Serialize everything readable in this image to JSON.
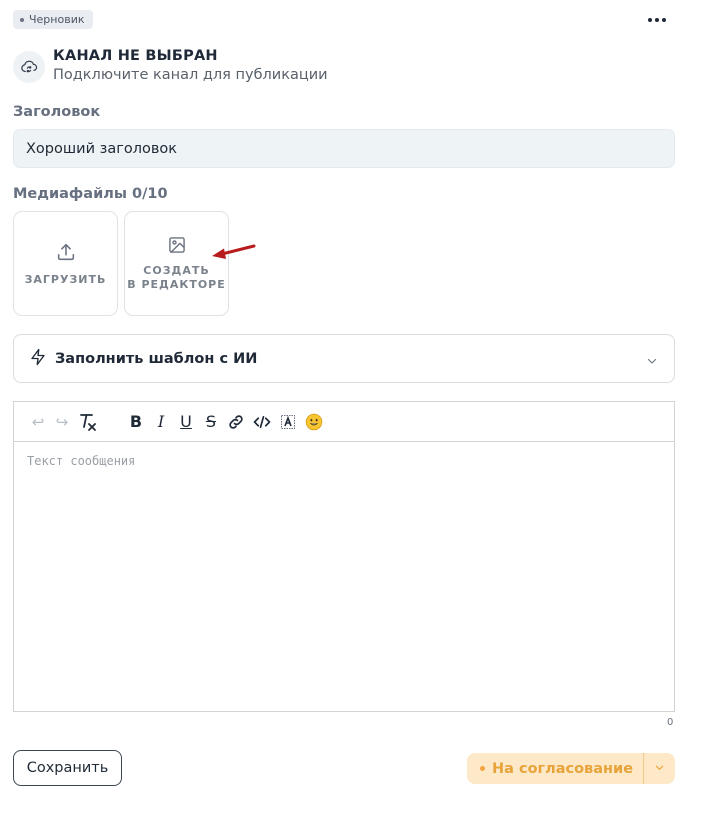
{
  "status": {
    "label": "Черновик"
  },
  "channel": {
    "title": "КАНАЛ НЕ ВЫБРАН",
    "subtitle": "Подключите канал для публикации"
  },
  "title_field": {
    "label": "Заголовок",
    "value": "Хороший заголовок"
  },
  "media": {
    "label": "Медиафайлы 0/10",
    "upload_label": "ЗАГРУЗИТЬ",
    "create_label": "СОЗДАТЬ\nВ РЕДАКТОРЕ"
  },
  "ai_template": {
    "label": "Заполнить шаблон с ИИ"
  },
  "editor": {
    "placeholder": "Текст сообщения",
    "value": "",
    "char_count": "0"
  },
  "actions": {
    "save_label": "Сохранить",
    "approve_label": "На согласование"
  },
  "colors": {
    "accent_orange": "#f2a541",
    "approve_bg": "#fde9c7",
    "arrow_red": "#b91c1c"
  },
  "icons": [
    "more-icon",
    "cloud-sync-icon",
    "upload-icon",
    "image-icon",
    "arrow-annotation",
    "lightning-icon",
    "chevron-down-icon",
    "undo-icon",
    "redo-icon",
    "clear-format-icon",
    "bold-icon",
    "italic-icon",
    "underline-icon",
    "strikethrough-icon",
    "link-icon",
    "code-icon",
    "spoiler-icon",
    "emoji-icon"
  ]
}
